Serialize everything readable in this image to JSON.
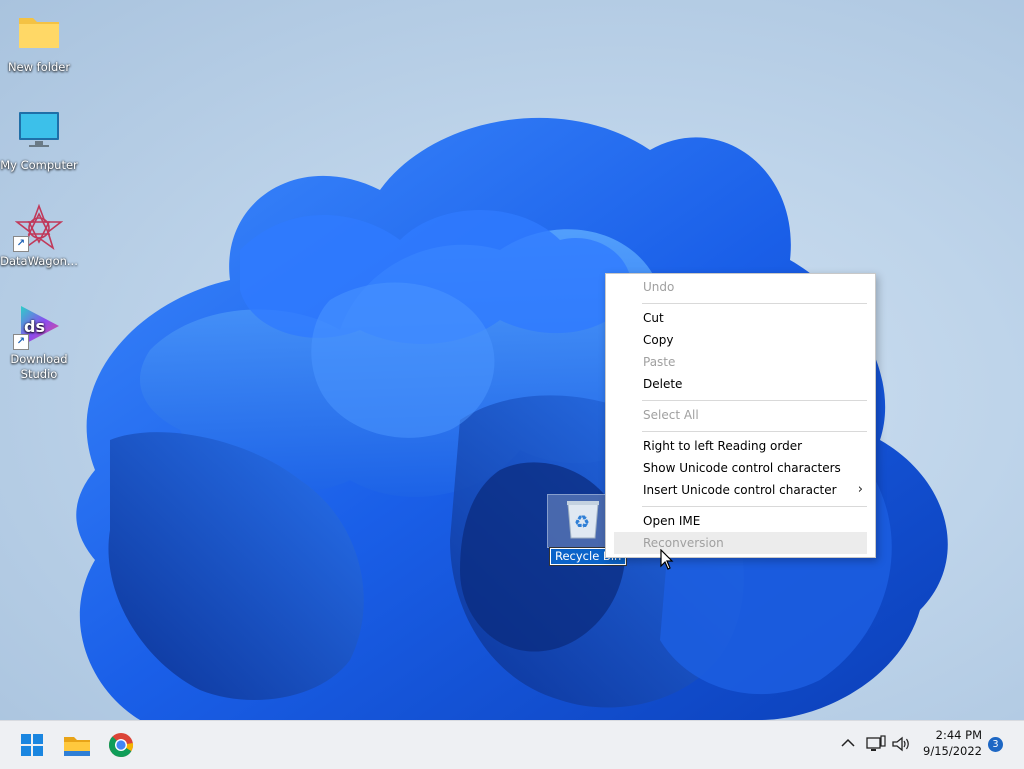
{
  "desktop": {
    "icons": [
      {
        "label": "New folder",
        "icon": "folder-icon"
      },
      {
        "label": "My Computer",
        "icon": "monitor-icon"
      },
      {
        "label": "DataWagon...",
        "icon": "datawagon-app-icon"
      },
      {
        "label": "Download Studio",
        "icon": "download-studio-icon"
      }
    ],
    "recycle_bin": {
      "label": "Recycle Bin",
      "icon": "recycle-bin-icon"
    }
  },
  "context_menu": {
    "items": [
      {
        "label": "Undo",
        "enabled": false
      },
      {
        "label": "Cut",
        "enabled": true
      },
      {
        "label": "Copy",
        "enabled": true
      },
      {
        "label": "Paste",
        "enabled": false
      },
      {
        "label": "Delete",
        "enabled": true
      },
      {
        "label": "Select All",
        "enabled": false
      },
      {
        "label": "Right to left Reading order",
        "enabled": true
      },
      {
        "label": "Show Unicode control characters",
        "enabled": true
      },
      {
        "label": "Insert Unicode control character",
        "enabled": true,
        "submenu": true
      },
      {
        "label": "Open IME",
        "enabled": true
      },
      {
        "label": "Reconversion",
        "enabled": false,
        "hovered": true
      }
    ]
  },
  "taskbar": {
    "pinned": [
      {
        "name": "start-button",
        "icon": "windows-logo-icon"
      },
      {
        "name": "file-explorer-button",
        "icon": "file-explorer-icon"
      },
      {
        "name": "chrome-button",
        "icon": "chrome-icon"
      }
    ],
    "tray": {
      "time": "2:44 PM",
      "date": "9/15/2022",
      "notification_count": "3"
    }
  },
  "colors": {
    "selection_blue": "#0a63c9",
    "taskbar_bg": "#eef0f3",
    "disabled_text": "#a0a0a0"
  }
}
